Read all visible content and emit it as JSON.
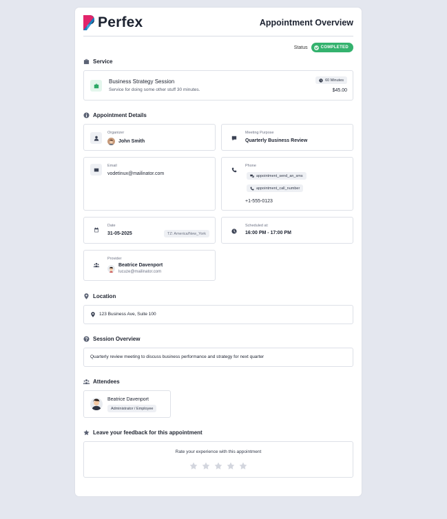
{
  "brand": {
    "name": "Perfex"
  },
  "header": {
    "title": "Appointment Overview"
  },
  "status": {
    "label": "Status",
    "value": "COMPLETED",
    "color": "#34b26e"
  },
  "service": {
    "section_title": "Service",
    "name": "Business Strategy Session",
    "description": "Service for doing some other stuff 30 minutes.",
    "duration": "60 Minutes",
    "price": "$45.00"
  },
  "details": {
    "section_title": "Appointment Details",
    "organizer": {
      "label": "Organizer",
      "value": "John Smith"
    },
    "meeting_purpose": {
      "label": "Meeting Purpose",
      "value": "Quarterly Business Review"
    },
    "email": {
      "label": "Email",
      "value": "vodetinux@mailinator.com"
    },
    "phone": {
      "label": "Phone",
      "sms_label": "appointment_send_an_sms",
      "call_label": "appointment_call_number",
      "value": "+1-555-0123"
    },
    "date": {
      "label": "Date",
      "value": "31-05-2025",
      "tz": "TZ: America/New_York"
    },
    "scheduled": {
      "label": "Scheduled at:",
      "value": "16:00 PM - 17:00 PM"
    },
    "provider": {
      "label": "Provider",
      "name": "Beatrice Davenport",
      "email": "lucuze@mailinator.com"
    }
  },
  "location": {
    "section_title": "Location",
    "value": "123 Business Ave, Suite 100"
  },
  "session": {
    "section_title": "Session Overview",
    "value": "Quarterly review meeting to discuss business performance and strategy for next quarter"
  },
  "attendees": {
    "section_title": "Attendees",
    "items": [
      {
        "name": "Beatrice Davenport",
        "role": "Administrator / Employee"
      }
    ]
  },
  "feedback": {
    "section_title": "Leave your feedback for this appointment",
    "prompt": "Rate your experience with this appointment",
    "rating": 0,
    "max": 5
  }
}
